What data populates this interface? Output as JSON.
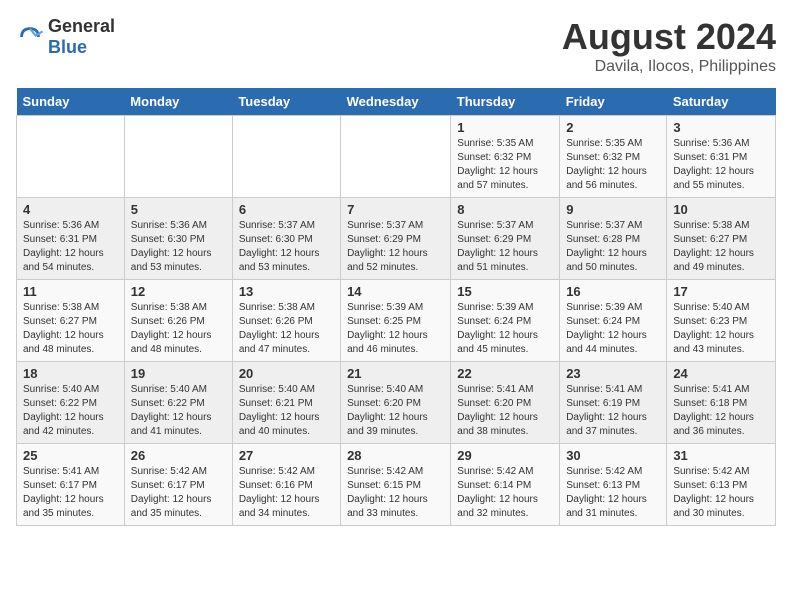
{
  "logo": {
    "general": "General",
    "blue": "Blue"
  },
  "title": "August 2024",
  "subtitle": "Davila, Ilocos, Philippines",
  "days_of_week": [
    "Sunday",
    "Monday",
    "Tuesday",
    "Wednesday",
    "Thursday",
    "Friday",
    "Saturday"
  ],
  "weeks": [
    [
      {
        "day": "",
        "info": ""
      },
      {
        "day": "",
        "info": ""
      },
      {
        "day": "",
        "info": ""
      },
      {
        "day": "",
        "info": ""
      },
      {
        "day": "1",
        "info": "Sunrise: 5:35 AM\nSunset: 6:32 PM\nDaylight: 12 hours and 57 minutes."
      },
      {
        "day": "2",
        "info": "Sunrise: 5:35 AM\nSunset: 6:32 PM\nDaylight: 12 hours and 56 minutes."
      },
      {
        "day": "3",
        "info": "Sunrise: 5:36 AM\nSunset: 6:31 PM\nDaylight: 12 hours and 55 minutes."
      }
    ],
    [
      {
        "day": "4",
        "info": "Sunrise: 5:36 AM\nSunset: 6:31 PM\nDaylight: 12 hours and 54 minutes."
      },
      {
        "day": "5",
        "info": "Sunrise: 5:36 AM\nSunset: 6:30 PM\nDaylight: 12 hours and 53 minutes."
      },
      {
        "day": "6",
        "info": "Sunrise: 5:37 AM\nSunset: 6:30 PM\nDaylight: 12 hours and 53 minutes."
      },
      {
        "day": "7",
        "info": "Sunrise: 5:37 AM\nSunset: 6:29 PM\nDaylight: 12 hours and 52 minutes."
      },
      {
        "day": "8",
        "info": "Sunrise: 5:37 AM\nSunset: 6:29 PM\nDaylight: 12 hours and 51 minutes."
      },
      {
        "day": "9",
        "info": "Sunrise: 5:37 AM\nSunset: 6:28 PM\nDaylight: 12 hours and 50 minutes."
      },
      {
        "day": "10",
        "info": "Sunrise: 5:38 AM\nSunset: 6:27 PM\nDaylight: 12 hours and 49 minutes."
      }
    ],
    [
      {
        "day": "11",
        "info": "Sunrise: 5:38 AM\nSunset: 6:27 PM\nDaylight: 12 hours and 48 minutes."
      },
      {
        "day": "12",
        "info": "Sunrise: 5:38 AM\nSunset: 6:26 PM\nDaylight: 12 hours and 48 minutes."
      },
      {
        "day": "13",
        "info": "Sunrise: 5:38 AM\nSunset: 6:26 PM\nDaylight: 12 hours and 47 minutes."
      },
      {
        "day": "14",
        "info": "Sunrise: 5:39 AM\nSunset: 6:25 PM\nDaylight: 12 hours and 46 minutes."
      },
      {
        "day": "15",
        "info": "Sunrise: 5:39 AM\nSunset: 6:24 PM\nDaylight: 12 hours and 45 minutes."
      },
      {
        "day": "16",
        "info": "Sunrise: 5:39 AM\nSunset: 6:24 PM\nDaylight: 12 hours and 44 minutes."
      },
      {
        "day": "17",
        "info": "Sunrise: 5:40 AM\nSunset: 6:23 PM\nDaylight: 12 hours and 43 minutes."
      }
    ],
    [
      {
        "day": "18",
        "info": "Sunrise: 5:40 AM\nSunset: 6:22 PM\nDaylight: 12 hours and 42 minutes."
      },
      {
        "day": "19",
        "info": "Sunrise: 5:40 AM\nSunset: 6:22 PM\nDaylight: 12 hours and 41 minutes."
      },
      {
        "day": "20",
        "info": "Sunrise: 5:40 AM\nSunset: 6:21 PM\nDaylight: 12 hours and 40 minutes."
      },
      {
        "day": "21",
        "info": "Sunrise: 5:40 AM\nSunset: 6:20 PM\nDaylight: 12 hours and 39 minutes."
      },
      {
        "day": "22",
        "info": "Sunrise: 5:41 AM\nSunset: 6:20 PM\nDaylight: 12 hours and 38 minutes."
      },
      {
        "day": "23",
        "info": "Sunrise: 5:41 AM\nSunset: 6:19 PM\nDaylight: 12 hours and 37 minutes."
      },
      {
        "day": "24",
        "info": "Sunrise: 5:41 AM\nSunset: 6:18 PM\nDaylight: 12 hours and 36 minutes."
      }
    ],
    [
      {
        "day": "25",
        "info": "Sunrise: 5:41 AM\nSunset: 6:17 PM\nDaylight: 12 hours and 35 minutes."
      },
      {
        "day": "26",
        "info": "Sunrise: 5:42 AM\nSunset: 6:17 PM\nDaylight: 12 hours and 35 minutes."
      },
      {
        "day": "27",
        "info": "Sunrise: 5:42 AM\nSunset: 6:16 PM\nDaylight: 12 hours and 34 minutes."
      },
      {
        "day": "28",
        "info": "Sunrise: 5:42 AM\nSunset: 6:15 PM\nDaylight: 12 hours and 33 minutes."
      },
      {
        "day": "29",
        "info": "Sunrise: 5:42 AM\nSunset: 6:14 PM\nDaylight: 12 hours and 32 minutes."
      },
      {
        "day": "30",
        "info": "Sunrise: 5:42 AM\nSunset: 6:13 PM\nDaylight: 12 hours and 31 minutes."
      },
      {
        "day": "31",
        "info": "Sunrise: 5:42 AM\nSunset: 6:13 PM\nDaylight: 12 hours and 30 minutes."
      }
    ]
  ]
}
